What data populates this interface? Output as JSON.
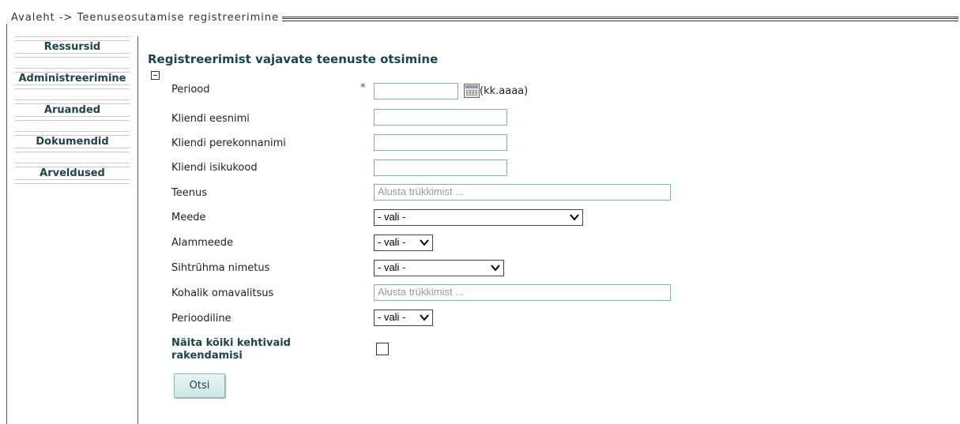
{
  "breadcrumb": {
    "text": "Avaleht -> Teenuseosutamise registreerimine"
  },
  "sidebar": {
    "items": [
      {
        "label": "Ressursid"
      },
      {
        "label": "Administreerimine"
      },
      {
        "label": "Aruanded"
      },
      {
        "label": "Dokumendid"
      },
      {
        "label": "Arveldused"
      }
    ]
  },
  "form": {
    "title": "Registreerimist vajavate teenuste otsimine",
    "required_mark": "*",
    "fields": {
      "periood": {
        "label": "Periood",
        "value": "",
        "format_hint": "(kk.aaaa)"
      },
      "eesnimi": {
        "label": "Kliendi eesnimi",
        "value": ""
      },
      "perekonnanimi": {
        "label": "Kliendi perekonnanimi",
        "value": ""
      },
      "isikukood": {
        "label": "Kliendi isikukood",
        "value": ""
      },
      "teenus": {
        "label": "Teenus",
        "placeholder": "Alusta trükkimist ..."
      },
      "meede": {
        "label": "Meede",
        "selected": "- vali -"
      },
      "alammeede": {
        "label": "Alammeede",
        "selected": "- vali -"
      },
      "sihtruhm": {
        "label": "Sihtrühma nimetus",
        "selected": "- vali -"
      },
      "kov": {
        "label": "Kohalik omavalitsus",
        "placeholder": "Alusta trükkimist ..."
      },
      "perioodiline": {
        "label": "Perioodiline",
        "selected": "- vali -"
      },
      "naita_koiki": {
        "label": "Näita kõiki kehtivaid rakendamisi",
        "checked": false
      }
    },
    "submit_label": "Otsi"
  },
  "colors": {
    "accent_text": "#1e4448",
    "input_border": "#7fb1b8",
    "required": "#d02020",
    "button_bg": "#cfe6e6"
  }
}
